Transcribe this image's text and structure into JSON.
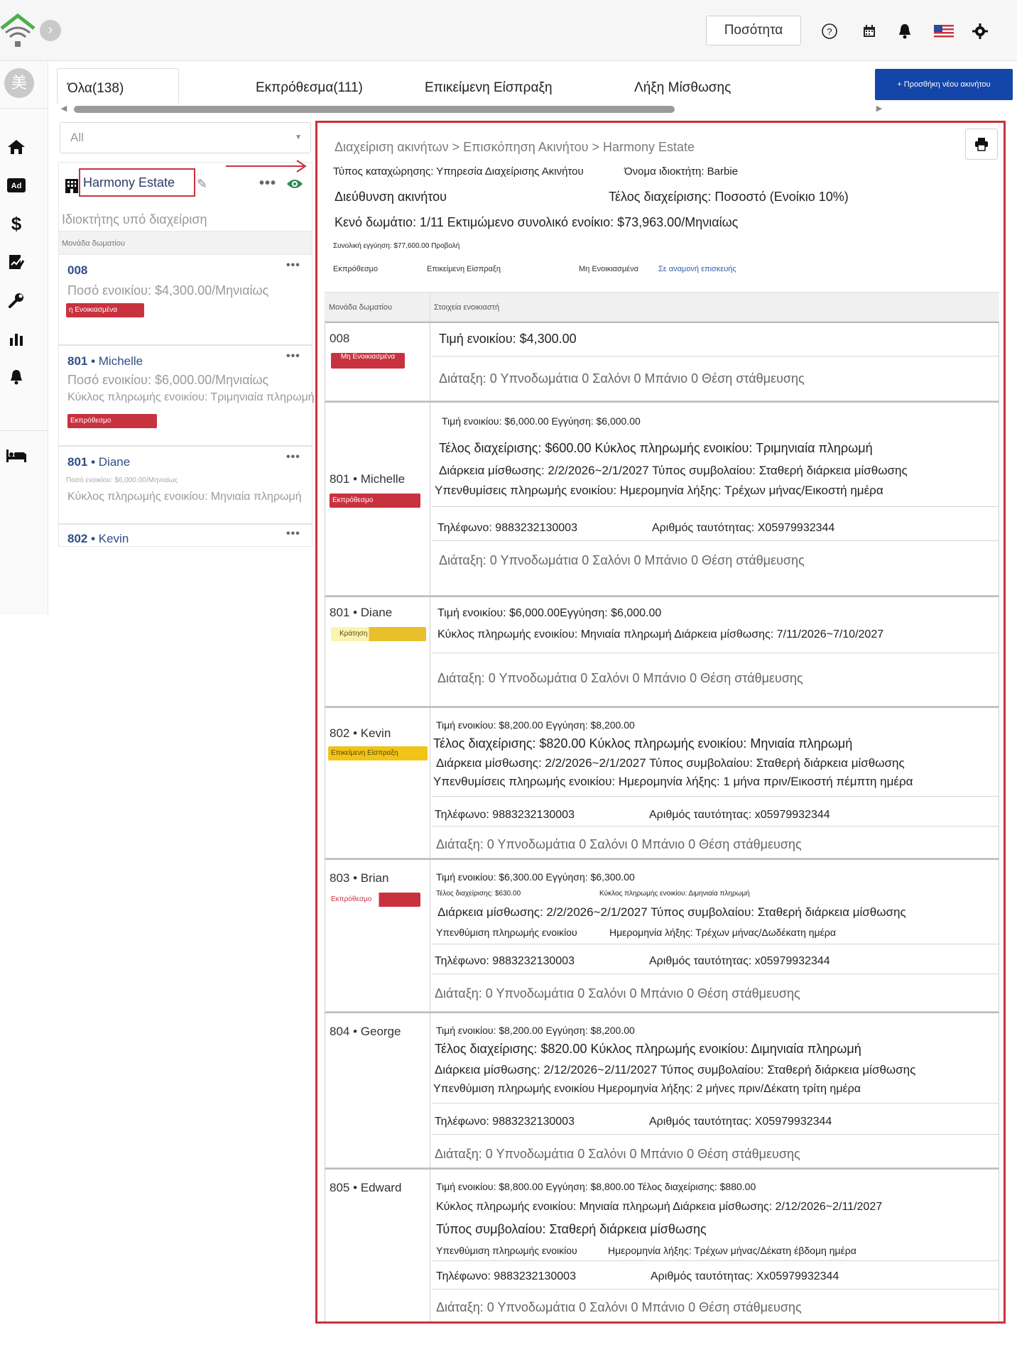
{
  "topbar": {
    "quantity_label": "Ποσότητα",
    "icons": [
      "help-icon",
      "calendar-icon",
      "bell-icon",
      "us-flag-icon",
      "gear-icon"
    ]
  },
  "sidebar": {
    "avatar_text": "美",
    "icons": [
      "home-icon",
      "ad-icon",
      "dollar-icon",
      "contract-icon",
      "wrench-icon",
      "chart-icon",
      "bell-icon",
      "bed-icon"
    ]
  },
  "tabs": [
    {
      "label": "Όλα(138)"
    },
    {
      "label": "Εκπρόθεσμα(111)"
    },
    {
      "label": "Επικείμενη Είσπραξη"
    },
    {
      "label": "Λήξη Μίσθωσης"
    }
  ],
  "add_button_label": "+ Προσθήκη νέου ακινήτου",
  "filter": {
    "value": "All"
  },
  "property_card": {
    "name": "Harmony Estate",
    "owner_type": "Ιδιοκτήτης υπό διαχείριση",
    "unit_header": "Μονάδα δωματίου",
    "items": [
      {
        "unit": "008",
        "name": "",
        "line1": "Ποσό ενοικίου: $4,300.00/Μηνιαίως",
        "line2": "",
        "badge": "η Ενοικιασμένα",
        "badge_color": "#c8323f"
      },
      {
        "unit": "801 • ",
        "name": "Michelle",
        "line1": "Ποσό ενοικίου: $6,000.00/Μηνιαίως",
        "line2": "Κύκλος πληρωμής ενοικίου: Τριμηνιαία πληρωμή",
        "badge": "Εκπρόθεσμο",
        "badge_color": "#c8323f"
      },
      {
        "unit": "801 • ",
        "name": "Diane",
        "line1": "Ποσό ενοικίου: $6,000.00/Μηνιαίως",
        "line2": "Κύκλος πληρωμής ενοικίου: Μηνιαία πληρωμή",
        "badge": "",
        "badge_color": ""
      },
      {
        "unit": "802 • ",
        "name": "Kevin",
        "line1": "",
        "line2": "",
        "badge": "",
        "badge_color": ""
      }
    ]
  },
  "detail": {
    "breadcrumb": "Διαχείριση ακινήτων > Επισκόπηση Ακινήτου > Harmony Estate",
    "listing_type": "Τύπος καταχώρησης: Υπηρεσία Διαχείρισης Ακινήτου",
    "owner_name": "Όνομα ιδιοκτήτη: Barbie",
    "address_label": "Διεύθυνση ακινήτου",
    "management_fee": "Τέλος διαχείρισης: Ποσοστό (Ενοίκιο 10%)",
    "vacancy": "Κενό δωμάτιο: 1/11 Εκτιμώμενο συνολικό ενοίκιο: $73,963.00/Μηνιαίως",
    "total_deposit": "Συνολική εγγύηση: $77,600.00 Προβολή",
    "sub_tabs": [
      "Εκπρόθεσμο",
      "Επικείμενη Είσπραξη",
      "Μη Ενοικιασμένα",
      "Σε αναμονή επισκευής"
    ],
    "table_header": {
      "unit": "Μονάδα δωματίου",
      "tenant": "Στοιχεία ενοικιαστή"
    },
    "rows": [
      {
        "unit": "008",
        "badge": "Μη Ενοικιασμένα",
        "badge_color": "#c8323f",
        "lines": [
          "Τιμή ενοικίου: $4,300.00",
          "Διάταξη: 0 Υπνοδωμάτια 0 Σαλόνι 0 Μπάνιο 0 Θέση στάθμευσης"
        ]
      },
      {
        "unit": "801 • Michelle",
        "badge": "Εκπρόθεσμο",
        "badge_color": "#c8323f",
        "lines": [
          "Τιμή ενοικίου: $6,000.00   Εγγύηση: $6,000.00",
          "Τέλος διαχείρισης: $600.00 Κύκλος πληρωμής ενοικίου: Τριμηνιαία πληρωμή",
          "Διάρκεια μίσθωσης: 2/2/2026~2/1/2027 Τύπος συμβολαίου: Σταθερή διάρκεια μίσθωσης",
          "Υπενθυμίσεις πληρωμής ενοικίου: Ημερομηνία λήξης: Τρέχων μήνας/Εικοστή ημέρα",
          "Τηλέφωνο: 9883232130003",
          "Αριθμός ταυτότητας: X05979932344",
          "Διάταξη: 0 Υπνοδωμάτια 0 Σαλόνι 0 Μπάνιο 0 Θέση στάθμευσης"
        ]
      },
      {
        "unit": "801 • Diane",
        "badge": "Κράτηση",
        "badge_color": "#e9c02b",
        "lines": [
          "Τιμή ενοικίου: $6,000.00Εγγύηση: $6,000.00",
          "Κύκλος πληρωμής ενοικίου: Μηνιαία πληρωμή Διάρκεια μίσθωσης: 7/11/2026~7/10/2027",
          "Διάταξη: 0 Υπνοδωμάτια 0 Σαλόνι 0 Μπάνιο 0 Θέση στάθμευσης"
        ]
      },
      {
        "unit": "802 • Kevin",
        "badge": "Επικείμενη Είσπραξη",
        "badge_color": "#f0c419",
        "lines": [
          "Τιμή ενοικίου: $8,200.00   Εγγύηση: $8,200.00",
          "Τέλος διαχείρισης: $820.00 Κύκλος πληρωμής ενοικίου: Μηνιαία πληρωμή",
          "Διάρκεια μίσθωσης: 2/2/2026~2/1/2027 Τύπος συμβολαίου: Σταθερή διάρκεια μίσθωσης",
          "Υπενθυμίσεις πληρωμής ενοικίου: Ημερομηνία λήξης: 1 μήνα πριν/Εικοστή πέμπτη ημέρα",
          "Τηλέφωνο: 9883232130003",
          "Αριθμός ταυτότητας: x05979932344",
          "Διάταξη: 0 Υπνοδωμάτια 0 Σαλόνι 0 Μπάνιο 0 Θέση στάθμευσης"
        ]
      },
      {
        "unit": "803 • Brian",
        "badge": "Εκπρόθεσμο",
        "badge_color": "#c8323f",
        "lines": [
          "Τιμή ενοικίου: $6,300.00   Εγγύηση: $6,300.00",
          "Τέλος διαχείρισης: $630.00",
          "Κύκλος πληρωμής ενοικίου: Διμηνιαία πληρωμή",
          "Διάρκεια μίσθωσης: 2/2/2026~2/1/2027 Τύπος συμβολαίου: Σταθερή διάρκεια μίσθωσης",
          "Υπενθύμιση πληρωμής ενοικίου",
          "Ημερομηνία λήξης: Τρέχων μήνας/Δωδέκατη ημέρα",
          "Τηλέφωνο: 9883232130003",
          "Αριθμός ταυτότητας: x05979932344",
          "Διάταξη: 0 Υπνοδωμάτια 0 Σαλόνι 0 Μπάνιο 0 Θέση στάθμευσης"
        ]
      },
      {
        "unit": "804 • George",
        "badge": "",
        "badge_color": "",
        "lines": [
          "Τιμή ενοικίου: $8,200.00   Εγγύηση: $8,200.00",
          "Τέλος διαχείρισης: $820.00 Κύκλος πληρωμής ενοικίου: Διμηνιαία πληρωμή",
          "Διάρκεια μίσθωσης: 2/12/2026~2/11/2027 Τύπος συμβολαίου: Σταθερή διάρκεια μίσθωσης",
          "Υπενθύμιση πληρωμής ενοικίου Ημερομηνία λήξης: 2 μήνες πριν/Δέκατη τρίτη ημέρα",
          "Τηλέφωνο: 9883232130003",
          "Αριθμός ταυτότητας: X05979932344",
          "Διάταξη: 0 Υπνοδωμάτια 0 Σαλόνι 0 Μπάνιο 0 Θέση στάθμευσης"
        ]
      },
      {
        "unit": "805 • Edward",
        "badge": "",
        "badge_color": "",
        "lines": [
          "Τιμή ενοικίου: $8,800.00   Εγγύηση: $8,800.00 Τέλος διαχείρισης: $880.00",
          "Κύκλος πληρωμής ενοικίου: Μηνιαία πληρωμή Διάρκεια μίσθωσης: 2/12/2026~2/11/2027",
          "Τύπος συμβολαίου: Σταθερή διάρκεια μίσθωσης",
          "Υπενθύμιση πληρωμής ενοικίου",
          "Ημερομηνία λήξης: Τρέχων μήνας/Δέκατη έβδομη ημέρα",
          "Τηλέφωνο: 9883232130003",
          "Αριθμός ταυτότητας: Xx05979932344",
          "Διάταξη: 0 Υπνοδωμάτια 0 Σαλόνι 0 Μπάνιο 0 Θέση στάθμευσης"
        ]
      }
    ]
  },
  "colors": {
    "accent": "#1346a8",
    "highlight": "#c8323f",
    "eye": "#2e8b57"
  }
}
